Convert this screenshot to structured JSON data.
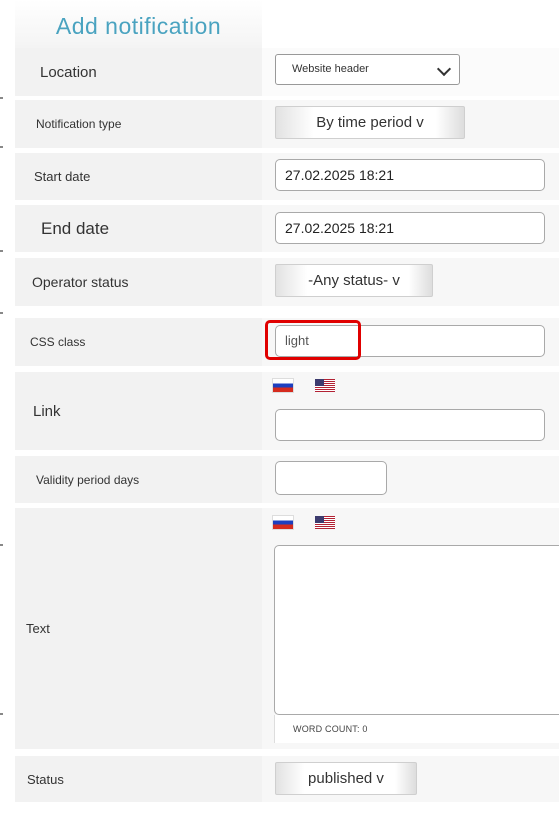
{
  "page": {
    "title": "Add notification"
  },
  "form": {
    "location": {
      "label": "Location",
      "value": "Website header"
    },
    "notification_type": {
      "label": "Notification type",
      "value": "By time period v"
    },
    "start_date": {
      "label": "Start date",
      "value": "27.02.2025 18:21"
    },
    "end_date": {
      "label": "End date",
      "value": "27.02.2025 18:21"
    },
    "operator_status": {
      "label": "Operator status",
      "value": "-Any status- v"
    },
    "css_class": {
      "label": "CSS class",
      "value": "light"
    },
    "link": {
      "label": "Link",
      "value": ""
    },
    "validity": {
      "label": "Validity period days",
      "value": ""
    },
    "text": {
      "label": "Text",
      "value": "",
      "word_count": "WORD COUNT: 0"
    },
    "status": {
      "label": "Status",
      "value": "published v"
    }
  },
  "languages": [
    {
      "code": "ru",
      "icon": "russian-flag-icon"
    },
    {
      "code": "en",
      "icon": "us-flag-icon"
    }
  ],
  "colors": {
    "title": "#4aa3c0",
    "highlight": "#e00000",
    "label_bg": "#f2f2f2"
  }
}
